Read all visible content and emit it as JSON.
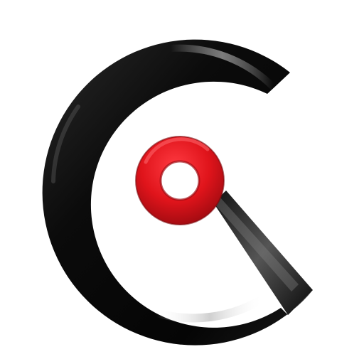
{
  "logo": {
    "shape": "letter G formed by a thick black glossy arc with a red ring at its center",
    "colors": {
      "arc_dark": "#0b0b0b",
      "arc_highlight": "#8c8c8c",
      "ring_red": "#e0141b",
      "ring_red_dark": "#9a0a10",
      "ring_highlight": "#ff4a50",
      "background": "#ffffff"
    }
  }
}
